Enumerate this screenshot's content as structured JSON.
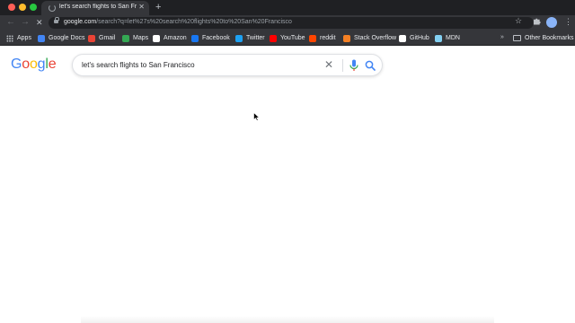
{
  "browser": {
    "tab": {
      "title": "let's search flights to San Francisco"
    },
    "new_tab_symbol": "+",
    "tab_close_symbol": "✕",
    "url": {
      "host": "google.com",
      "path": "/search?q=let%27s%20search%20flights%20to%20San%20Francisco"
    },
    "bookmarks": [
      {
        "label": "Apps",
        "icon": "apps-grid-icon",
        "color": "#bdc1c6"
      },
      {
        "label": "Google Docs",
        "icon": "google-docs-icon",
        "color": "#4285f4"
      },
      {
        "label": "Gmail",
        "icon": "gmail-icon",
        "color": "#ea4335"
      },
      {
        "label": "Maps",
        "icon": "maps-icon",
        "color": "#34a853"
      },
      {
        "label": "Amazon",
        "icon": "amazon-icon",
        "color": "#ffffff"
      },
      {
        "label": "Facebook",
        "icon": "facebook-icon",
        "color": "#1877f2"
      },
      {
        "label": "Twitter",
        "icon": "twitter-icon",
        "color": "#1da1f2"
      },
      {
        "label": "YouTube",
        "icon": "youtube-icon",
        "color": "#ff0000"
      },
      {
        "label": "reddit",
        "icon": "reddit-icon",
        "color": "#ff4500"
      },
      {
        "label": "Stack Overflow",
        "icon": "stack-overflow-icon",
        "color": "#f48024"
      },
      {
        "label": "GitHub",
        "icon": "github-icon",
        "color": "#ffffff"
      },
      {
        "label": "MDN",
        "icon": "mdn-icon",
        "color": "#83d0f2"
      }
    ],
    "overflow_symbol": "»",
    "other_bookmarks": "Other Bookmarks"
  },
  "google": {
    "logo_letters": [
      {
        "char": "G",
        "color": "#4285f4"
      },
      {
        "char": "o",
        "color": "#ea4335"
      },
      {
        "char": "o",
        "color": "#fbbc05"
      },
      {
        "char": "g",
        "color": "#4285f4"
      },
      {
        "char": "l",
        "color": "#34a853"
      },
      {
        "char": "e",
        "color": "#ea4335"
      }
    ],
    "query": "let's search flights to San Francisco",
    "clear_symbol": "✕"
  }
}
